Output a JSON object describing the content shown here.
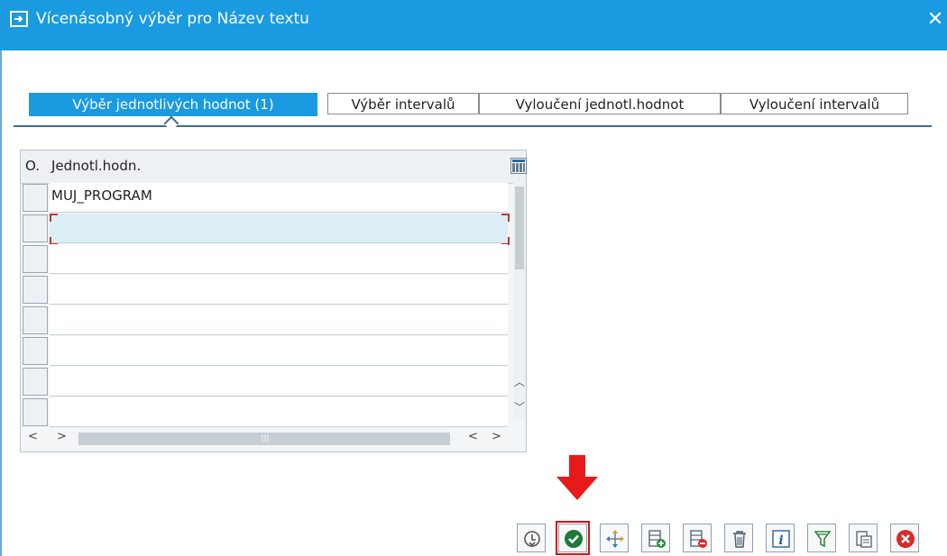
{
  "window": {
    "title": "Vícenásobný výběr pro Název textu",
    "close_symbol": "✕"
  },
  "tabs": [
    {
      "label": "Výběr jednotlivých hodnot (1)",
      "active": true
    },
    {
      "label": "Výběr intervalů",
      "active": false
    },
    {
      "label": "Vyloučení jednotl.hodnot",
      "active": false
    },
    {
      "label": "Vyloučení intervalů",
      "active": false
    }
  ],
  "table": {
    "columns": {
      "option": "O.",
      "value": "Jednotl.hodn."
    },
    "rows": [
      {
        "value": "MUJ_PROGRAM"
      },
      {
        "value": ""
      },
      {
        "value": ""
      },
      {
        "value": ""
      },
      {
        "value": ""
      },
      {
        "value": ""
      },
      {
        "value": ""
      },
      {
        "value": ""
      }
    ],
    "focused_row": 1
  },
  "toolbar": {
    "buttons": [
      {
        "icon": "clock-arrow-icon",
        "name": "history-button"
      },
      {
        "icon": "check-circle-icon",
        "name": "confirm-button",
        "highlighted": true
      },
      {
        "icon": "move-icon",
        "name": "move-button"
      },
      {
        "icon": "insert-row-icon",
        "name": "insert-row-button"
      },
      {
        "icon": "delete-row-icon",
        "name": "delete-row-button"
      },
      {
        "icon": "trash-icon",
        "name": "delete-all-button"
      },
      {
        "icon": "info-icon",
        "name": "info-button"
      },
      {
        "icon": "filter-icon",
        "name": "filter-button"
      },
      {
        "icon": "paste-icon",
        "name": "paste-button"
      },
      {
        "icon": "cancel-icon",
        "name": "cancel-button"
      }
    ]
  },
  "colors": {
    "titlebar": "#1a9ae0",
    "active_tab": "#1a9ae0",
    "highlight": "#d01515",
    "confirm_green": "#1f7a3a",
    "cancel_red": "#d62b2b"
  }
}
